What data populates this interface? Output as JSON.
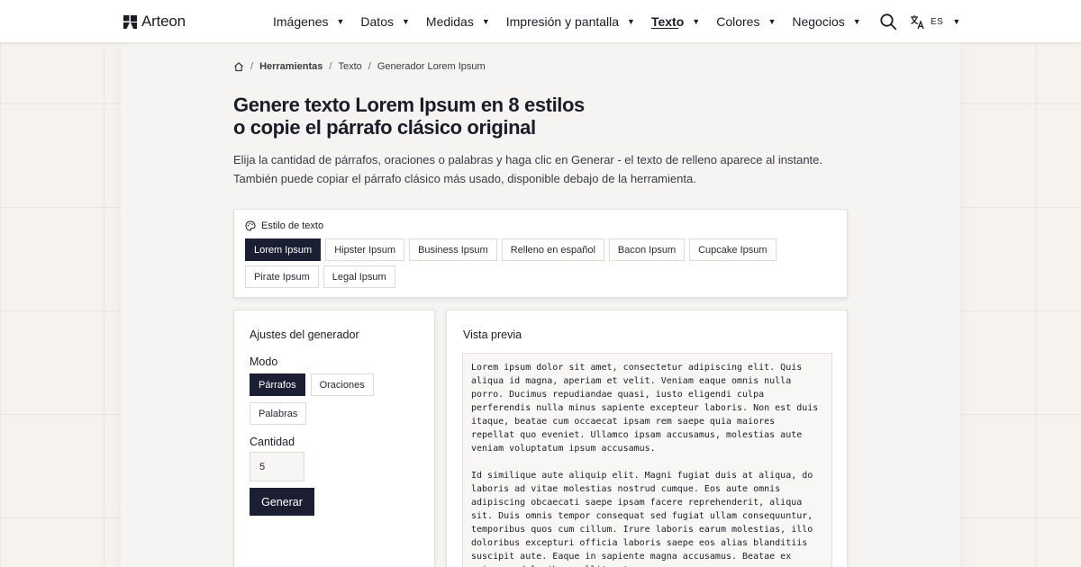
{
  "header": {
    "logo_text": "Arteon",
    "nav": [
      {
        "label": "Imágenes",
        "active": false
      },
      {
        "label": "Datos",
        "active": false
      },
      {
        "label": "Medidas",
        "active": false
      },
      {
        "label": "Impresión y pantalla",
        "active": false
      },
      {
        "label": "Texto",
        "active": true
      },
      {
        "label": "Colores",
        "active": false
      },
      {
        "label": "Negocios",
        "active": false
      }
    ],
    "lang_code": "ES"
  },
  "breadcrumb": {
    "items": [
      "Herramientas",
      "Texto"
    ],
    "current": "Generador Lorem Ipsum"
  },
  "page": {
    "title_line1": "Genere texto Lorem Ipsum en 8 estilos",
    "title_line2": "o copie el párrafo clásico original",
    "lead_line1": "Elija la cantidad de párrafos, oraciones o palabras y haga clic en Generar - el texto de relleno aparece al instante.",
    "lead_line2": "También puede copiar el párrafo clásico más usado, disponible debajo de la herramienta."
  },
  "styles": {
    "heading": "Estilo de texto",
    "options": [
      "Lorem Ipsum",
      "Hipster Ipsum",
      "Business Ipsum",
      "Relleno en español",
      "Bacon Ipsum",
      "Cupcake Ipsum",
      "Pirate Ipsum",
      "Legal Ipsum"
    ],
    "selected": "Lorem Ipsum"
  },
  "settings": {
    "title": "Ajustes del generador",
    "mode_label": "Modo",
    "modes": [
      "Párrafos",
      "Oraciones",
      "Palabras"
    ],
    "selected_mode": "Párrafos",
    "quantity_label": "Cantidad",
    "quantity_value": "5",
    "generate_label": "Generar"
  },
  "preview": {
    "title": "Vista previa",
    "paragraphs": [
      "Lorem ipsum dolor sit amet, consectetur adipiscing elit. Quis aliqua id magna, aperiam et velit. Veniam eaque omnis nulla porro. Ducimus repudiandae quasi, iusto eligendi culpa perferendis nulla minus sapiente excepteur laboris. Non est duis itaque, beatae cum occaecat ipsam rem saepe quia maiores repellat quo eveniet. Ullamco ipsam accusamus, molestias aute veniam voluptatum ipsum accusamus.",
      "Id similique aute aliquip elit. Magni fugiat duis at aliqua, do laboris ad vitae molestias nostrud cumque. Eos aute omnis adipiscing obcaecati saepe ipsam facere reprehenderit, aliqua sit. Duis omnis tempor consequat sed fugiat ullam consequuntur, temporibus quos cum cillum. Irure laboris earum molestias, illo doloribus excepturi officia laboris saepe eos alias blanditiis suscipit aute. Eaque in sapiente magna accusamus. Beatae ex quisquam doloribus mollit est."
    ]
  },
  "icons": {
    "logo": "logo-mark-icon",
    "search": "search-icon",
    "language": "translate-icon",
    "home": "home-icon",
    "palette": "palette-icon",
    "caret": "caret-down-icon"
  },
  "colors": {
    "accent_dark": "#1c1f33",
    "page_bg": "#f6f3ef",
    "panel_bg": "#f5f4f2"
  }
}
